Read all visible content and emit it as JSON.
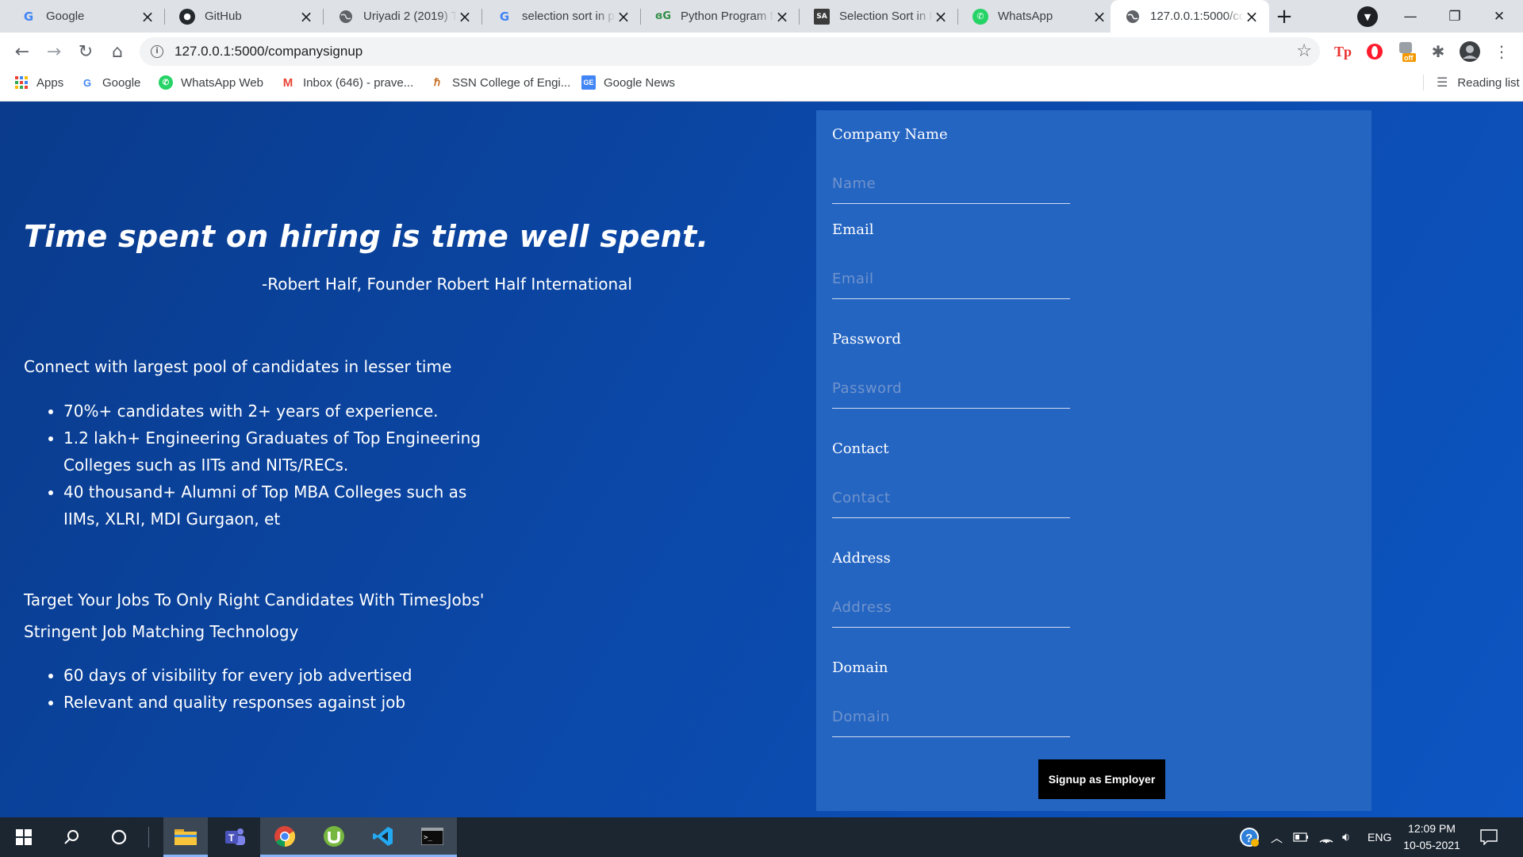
{
  "browser": {
    "tabs": [
      {
        "title": "Google",
        "icon": "google-icon",
        "active": false
      },
      {
        "title": "GitHub",
        "icon": "github-icon",
        "active": false
      },
      {
        "title": "Uriyadi 2 (2019) Tamil",
        "icon": "globe-icon",
        "active": false
      },
      {
        "title": "selection sort in python",
        "icon": "google-icon",
        "active": false
      },
      {
        "title": "Python Program for Selection Sort",
        "icon": "geeksforgeeks-icon",
        "active": false
      },
      {
        "title": "Selection Sort in Python",
        "icon": "stackabuse-icon",
        "active": false
      },
      {
        "title": "WhatsApp",
        "icon": "whatsapp-icon",
        "active": false
      },
      {
        "title": "127.0.0.1:5000/companysignup",
        "icon": "globe-icon",
        "active": true
      }
    ],
    "url": "127.0.0.1:5000/companysignup",
    "bookmarks": [
      {
        "label": "Apps",
        "icon": "apps-grid-icon"
      },
      {
        "label": "Google",
        "icon": "google-icon"
      },
      {
        "label": "WhatsApp Web",
        "icon": "whatsapp-icon"
      },
      {
        "label": "Inbox (646) - prave...",
        "icon": "gmail-icon"
      },
      {
        "label": "SSN College of Engi...",
        "icon": "ssn-icon"
      },
      {
        "label": "Google News",
        "icon": "google-news-icon"
      }
    ],
    "reading_list": "Reading list",
    "colors": {
      "tabstrip": "#dee1e6",
      "active_tab": "#ffffff"
    }
  },
  "page": {
    "quote": "Time spent on hiring is time well spent.",
    "author": "-Robert Half, Founder Robert Half International",
    "section1_heading": "Connect with largest pool of candidates in lesser time",
    "section1_items": [
      "70%+ candidates with 2+ years of experience.",
      "1.2 lakh+ Engineering Graduates of Top Engineering Colleges such as IITs and NITs/RECs.",
      "40 thousand+ Alumni of Top MBA Colleges such as IIMs, XLRI, MDI Gurgaon, et"
    ],
    "section2_heading": "Target Your Jobs To Only Right Candidates With TimesJobs' Stringent Job Matching Technology",
    "section2_items": [
      "60 days of visibility for every job advertised",
      "Relevant and quality responses against job"
    ],
    "form": {
      "fields": [
        {
          "label": "Company Name",
          "placeholder": "Name"
        },
        {
          "label": "Email",
          "placeholder": "Email"
        },
        {
          "label": "Password",
          "placeholder": "Password"
        },
        {
          "label": "Contact",
          "placeholder": "Contact"
        },
        {
          "label": "Address",
          "placeholder": "Address"
        },
        {
          "label": "Domain",
          "placeholder": "Domain"
        }
      ],
      "submit_label": "Signup as Employer"
    },
    "colors": {
      "background": "#0b48a8",
      "card": "#2565c2",
      "button": "#000000"
    }
  },
  "taskbar": {
    "language": "ENG",
    "time": "12:09 PM",
    "date": "10-05-2021",
    "colors": {
      "background": "#1c2631"
    }
  }
}
